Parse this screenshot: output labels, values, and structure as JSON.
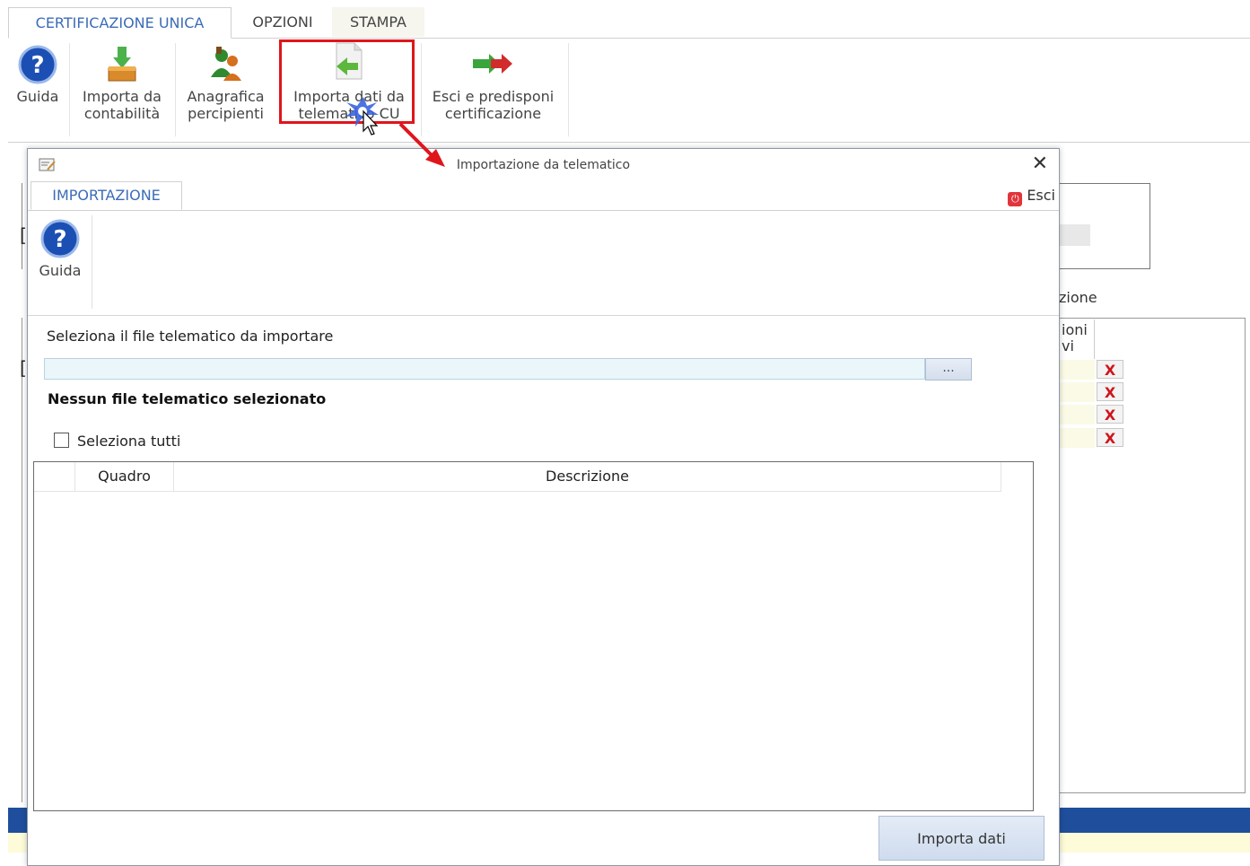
{
  "app": {
    "tabs": [
      {
        "label": "CERTIFICAZIONE UNICA",
        "active": true
      },
      {
        "label": "OPZIONI",
        "active": false
      },
      {
        "label": "STAMPA",
        "active": false
      }
    ],
    "ribbon": [
      {
        "line1": "Guida",
        "line2": "",
        "icon": "help-icon"
      },
      {
        "line1": "Importa da",
        "line2": "contabilità",
        "icon": "import-box-icon"
      },
      {
        "line1": "Anagrafica",
        "line2": "percipienti",
        "icon": "people-icon"
      },
      {
        "line1": "Importa dati da",
        "line2": "telematico CU",
        "icon": "import-file-icon"
      },
      {
        "line1": "Esci e predisponi",
        "line2": "certificazione",
        "icon": "exit-arrow-icon"
      }
    ],
    "background": {
      "column_label": "zione",
      "panel_header_line1": "ioni",
      "panel_header_line2": "vi",
      "delete_symbol": "X"
    }
  },
  "dialog": {
    "title": "Importazione da telematico",
    "close_symbol": "✕",
    "tab": "IMPORTAZIONE",
    "exit_label": "Esci",
    "guide_label": "Guida",
    "select_file_label": "Seleziona il file telematico da importare",
    "file_path_value": "",
    "browse_label": "...",
    "no_file_message": "Nessun file telematico selezionato",
    "select_all_label": "Seleziona tutti",
    "select_all_checked": false,
    "table": {
      "columns": [
        "",
        "Quadro",
        "Descrizione"
      ],
      "rows": []
    },
    "import_button": "Importa dati"
  },
  "colors": {
    "accent_blue": "#3b6cb8",
    "highlight_red": "#e0151b",
    "status_bar_blue": "#1f4f9c"
  }
}
